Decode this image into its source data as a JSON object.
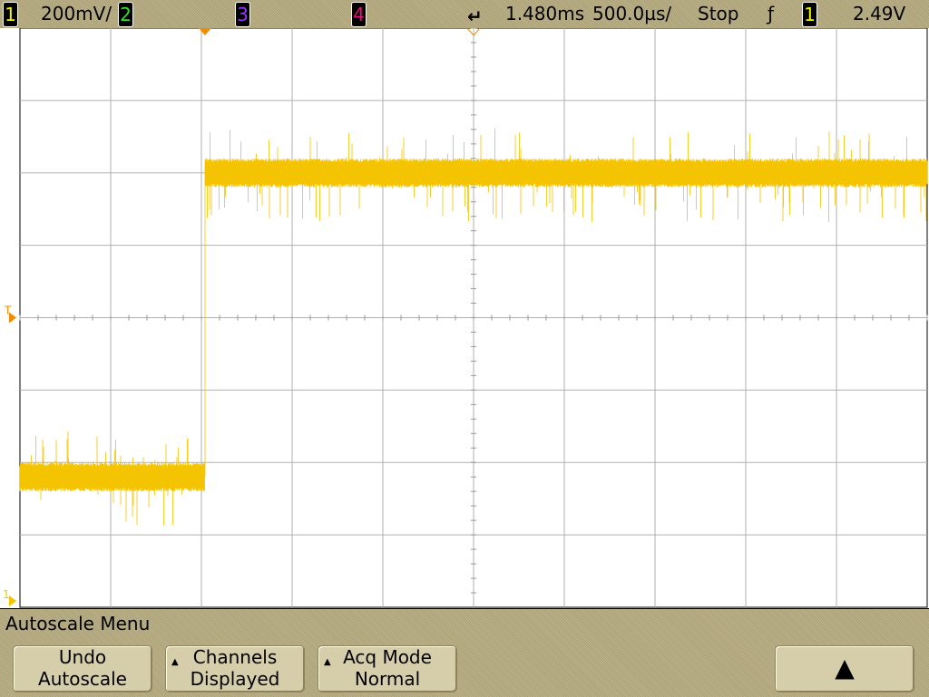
{
  "status_bar": {
    "ch1_label": "1",
    "ch1_scale": "200mV/",
    "ch2_label": "2",
    "ch3_label": "3",
    "ch4_label": "4",
    "time_delay": "1.480ms",
    "time_scale": "500.0µs/",
    "run_state": "Stop",
    "trigger_slope_icon": "rising-edge-icon",
    "trigger_source": "1",
    "trigger_level": "2.49V"
  },
  "colors": {
    "ch1": "#f5c400",
    "ch2": "#22cc22",
    "ch3": "#8a2be2",
    "ch4": "#e0157a",
    "trace": "#f5c400",
    "marker": "#f08c00"
  },
  "markers": {
    "trigger_level_marker": "T",
    "ground_marker": "1"
  },
  "chart_data": {
    "type": "line",
    "title": "",
    "x_divisions": 10,
    "y_divisions": 8,
    "xlabel": "",
    "ylabel": "",
    "series": [
      {
        "name": "Channel 1",
        "description": "noisy step",
        "low_level_div": 1.8,
        "high_level_div": 6.0,
        "step_time_div": 2.04,
        "noise_div": 0.3
      }
    ]
  },
  "softkeys": {
    "menu_title": "Autoscale Menu",
    "undo": {
      "line1": "Undo",
      "line2": "Autoscale"
    },
    "channels": {
      "line1": "Channels",
      "line2": "Displayed"
    },
    "acq": {
      "line1": "Acq Mode",
      "line2": "Normal"
    }
  }
}
